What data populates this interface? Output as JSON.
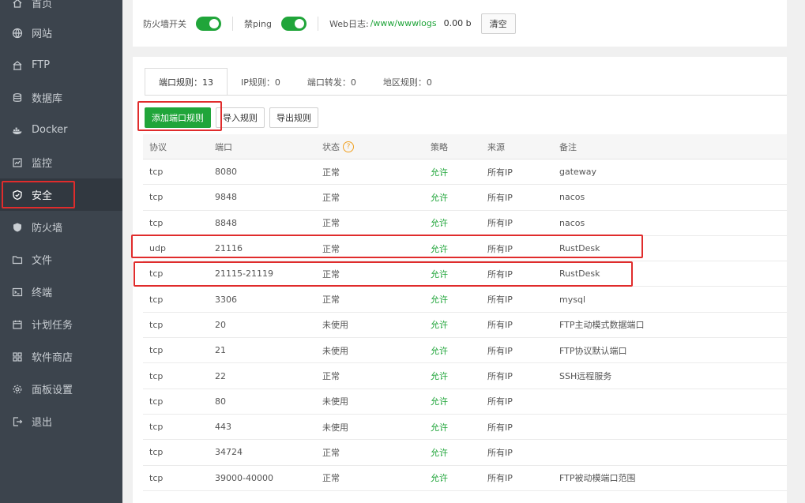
{
  "sidebar": {
    "items": [
      {
        "label": "首页",
        "icon": "home-icon"
      },
      {
        "label": "网站",
        "icon": "globe-icon"
      },
      {
        "label": "FTP",
        "icon": "ftp-icon"
      },
      {
        "label": "数据库",
        "icon": "database-icon"
      },
      {
        "label": "Docker",
        "icon": "docker-icon"
      },
      {
        "label": "监控",
        "icon": "monitor-icon"
      },
      {
        "label": "安全",
        "icon": "shield-icon",
        "active": true
      },
      {
        "label": "防火墙",
        "icon": "firewall-icon"
      },
      {
        "label": "文件",
        "icon": "folder-icon"
      },
      {
        "label": "终端",
        "icon": "terminal-icon"
      },
      {
        "label": "计划任务",
        "icon": "calendar-icon"
      },
      {
        "label": "软件商店",
        "icon": "apps-icon"
      },
      {
        "label": "面板设置",
        "icon": "gear-icon"
      },
      {
        "label": "退出",
        "icon": "logout-icon"
      }
    ]
  },
  "topbar": {
    "firewall_switch_label": "防火墙开关",
    "ping_label": "禁ping",
    "weblog_label": "Web日志:",
    "weblog_path": "/www/wwwlogs",
    "weblog_size": "0.00 b",
    "clear_label": "清空"
  },
  "tabs": [
    {
      "label": "端口规则：13",
      "active": true
    },
    {
      "label": "IP规则：0"
    },
    {
      "label": "端口转发：0"
    },
    {
      "label": "地区规则：0"
    }
  ],
  "actions": {
    "add_label": "添加端口规则",
    "import_label": "导入规则",
    "export_label": "导出规则"
  },
  "table": {
    "headers": [
      "协议",
      "端口",
      "状态",
      "策略",
      "来源",
      "备注"
    ],
    "status_help": "?",
    "rows": [
      [
        "tcp",
        "8080",
        "正常",
        "允许",
        "所有IP",
        "gateway"
      ],
      [
        "tcp",
        "9848",
        "正常",
        "允许",
        "所有IP",
        "nacos"
      ],
      [
        "tcp",
        "8848",
        "正常",
        "允许",
        "所有IP",
        "nacos"
      ],
      [
        "udp",
        "21116",
        "正常",
        "允许",
        "所有IP",
        "RustDesk"
      ],
      [
        "tcp",
        "21115-21119",
        "正常",
        "允许",
        "所有IP",
        "RustDesk"
      ],
      [
        "tcp",
        "3306",
        "正常",
        "允许",
        "所有IP",
        "mysql"
      ],
      [
        "tcp",
        "20",
        "未使用",
        "允许",
        "所有IP",
        "FTP主动模式数据端口"
      ],
      [
        "tcp",
        "21",
        "未使用",
        "允许",
        "所有IP",
        "FTP协议默认端口"
      ],
      [
        "tcp",
        "22",
        "正常",
        "允许",
        "所有IP",
        "SSH远程服务"
      ],
      [
        "tcp",
        "80",
        "未使用",
        "允许",
        "所有IP",
        ""
      ],
      [
        "tcp",
        "443",
        "未使用",
        "允许",
        "所有IP",
        ""
      ],
      [
        "tcp",
        "34724",
        "正常",
        "允许",
        "所有IP",
        ""
      ],
      [
        "tcp",
        "39000-40000",
        "正常",
        "允许",
        "所有IP",
        "FTP被动模端口范围"
      ]
    ]
  },
  "colors": {
    "accent": "#20a53a",
    "highlight": "#e02c2c",
    "sidebar": "#3c444d"
  }
}
